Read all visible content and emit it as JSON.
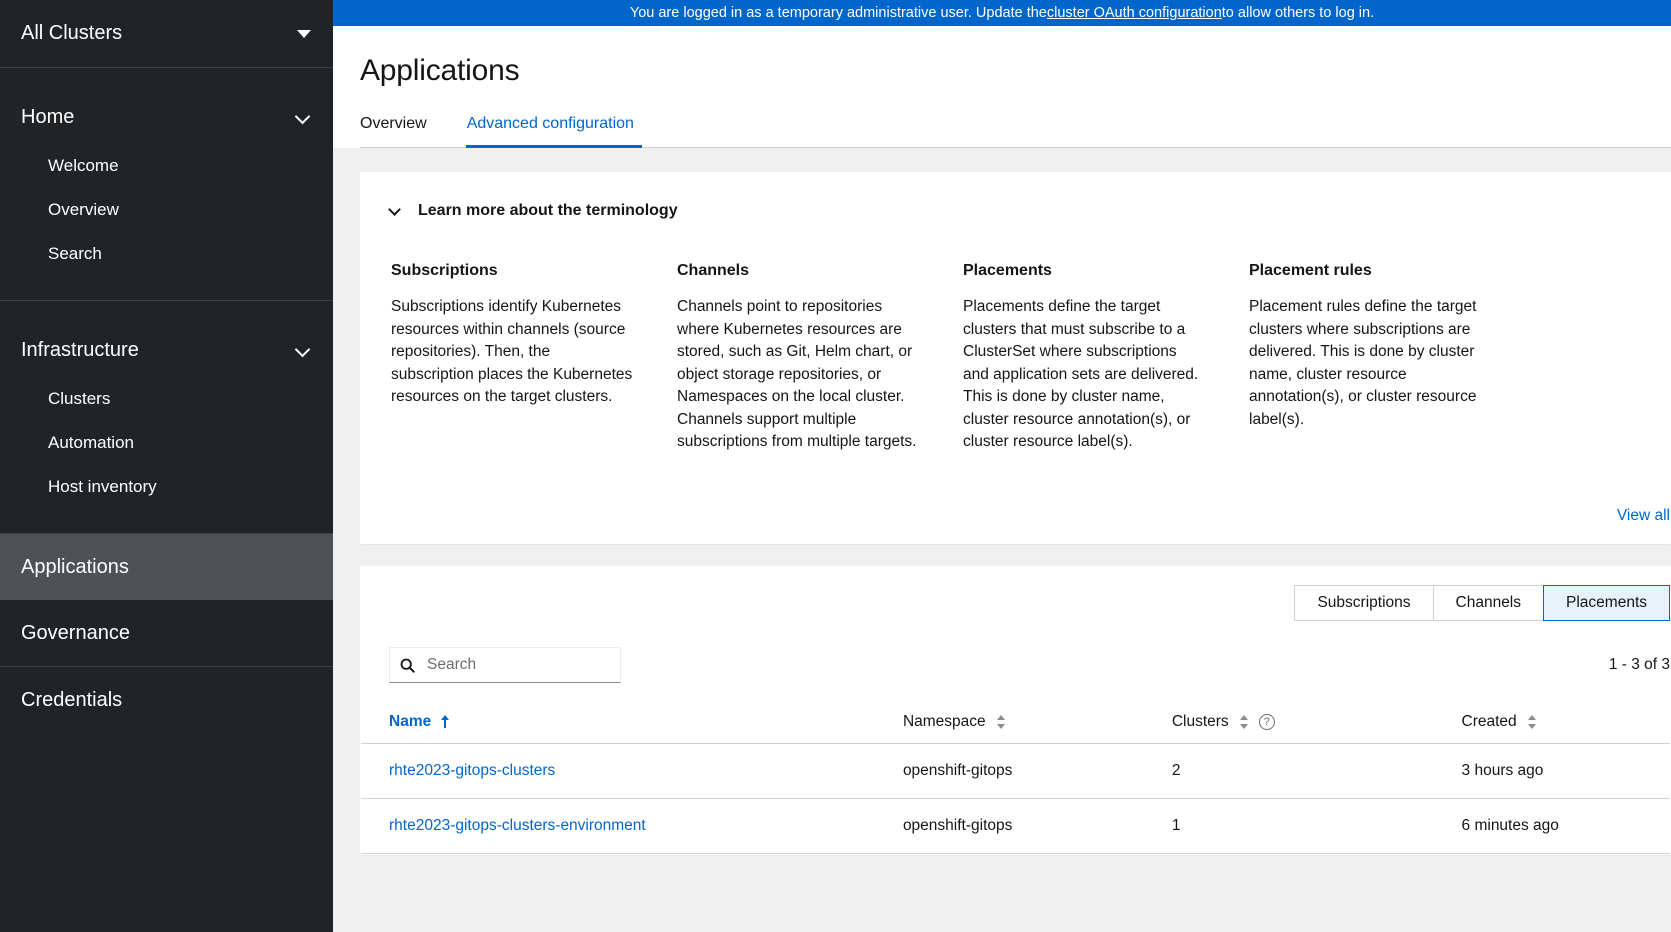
{
  "banner": {
    "text_before": "You are logged in as a temporary administrative user. Update the ",
    "link": "cluster OAuth configuration",
    "text_after": " to allow others to log in."
  },
  "sidebar": {
    "cluster_selector": "All Clusters",
    "groups": [
      {
        "title": "Home",
        "items": [
          {
            "label": "Welcome"
          },
          {
            "label": "Overview"
          },
          {
            "label": "Search"
          }
        ]
      },
      {
        "title": "Infrastructure",
        "items": [
          {
            "label": "Clusters"
          },
          {
            "label": "Automation"
          },
          {
            "label": "Host inventory"
          }
        ]
      }
    ],
    "top_items": [
      {
        "label": "Applications",
        "active": true
      },
      {
        "label": "Governance",
        "active": false
      },
      {
        "label": "Credentials",
        "active": false
      }
    ]
  },
  "page": {
    "title": "Applications",
    "tabs": [
      {
        "label": "Overview",
        "active": false
      },
      {
        "label": "Advanced configuration",
        "active": true
      }
    ]
  },
  "terminology": {
    "toggle_label": "Learn more about the terminology",
    "view_all_label": "View all",
    "columns": [
      {
        "heading": "Subscriptions",
        "body": "Subscriptions identify Kubernetes resources within channels (source repositories). Then, the subscription places the Kubernetes resources on the target clusters."
      },
      {
        "heading": "Channels",
        "body": "Channels point to repositories where Kubernetes resources are stored, such as Git, Helm chart, or object storage repositories, or Namespaces on the local cluster. Channels support multiple subscriptions from multiple targets."
      },
      {
        "heading": "Placements",
        "body": "Placements define the target clusters that must subscribe to a ClusterSet where subscriptions and application sets are delivered. This is done by cluster name, cluster resource annotation(s), or cluster resource label(s)."
      },
      {
        "heading": "Placement rules",
        "body": "Placement rules define the target clusters where subscriptions are delivered. This is done by cluster name, cluster resource annotation(s), or cluster resource label(s)."
      }
    ]
  },
  "resource_toggle": {
    "buttons": [
      {
        "label": "Subscriptions",
        "selected": false
      },
      {
        "label": "Channels",
        "selected": false
      },
      {
        "label": "Placements",
        "selected": true
      }
    ]
  },
  "search": {
    "placeholder": "Search",
    "value": "",
    "icon": "search-icon"
  },
  "pagination": {
    "text": "1 - 3 of 3"
  },
  "table": {
    "columns": [
      {
        "label": "Name",
        "sort": "asc"
      },
      {
        "label": "Namespace",
        "sort": "none"
      },
      {
        "label": "Clusters",
        "sort": "none",
        "help": "?"
      },
      {
        "label": "Created",
        "sort": "none"
      }
    ],
    "rows": [
      {
        "name": "rhte2023-gitops-clusters",
        "namespace": "openshift-gitops",
        "clusters": "2",
        "created": "3 hours ago"
      },
      {
        "name": "rhte2023-gitops-clusters-environment",
        "namespace": "openshift-gitops",
        "clusters": "1",
        "created": "6 minutes ago"
      }
    ]
  },
  "colors": {
    "brand_blue": "#0066cc",
    "sidebar_bg": "#212427",
    "sidebar_active": "#4f5255",
    "content_bg": "#f0f0f0"
  }
}
